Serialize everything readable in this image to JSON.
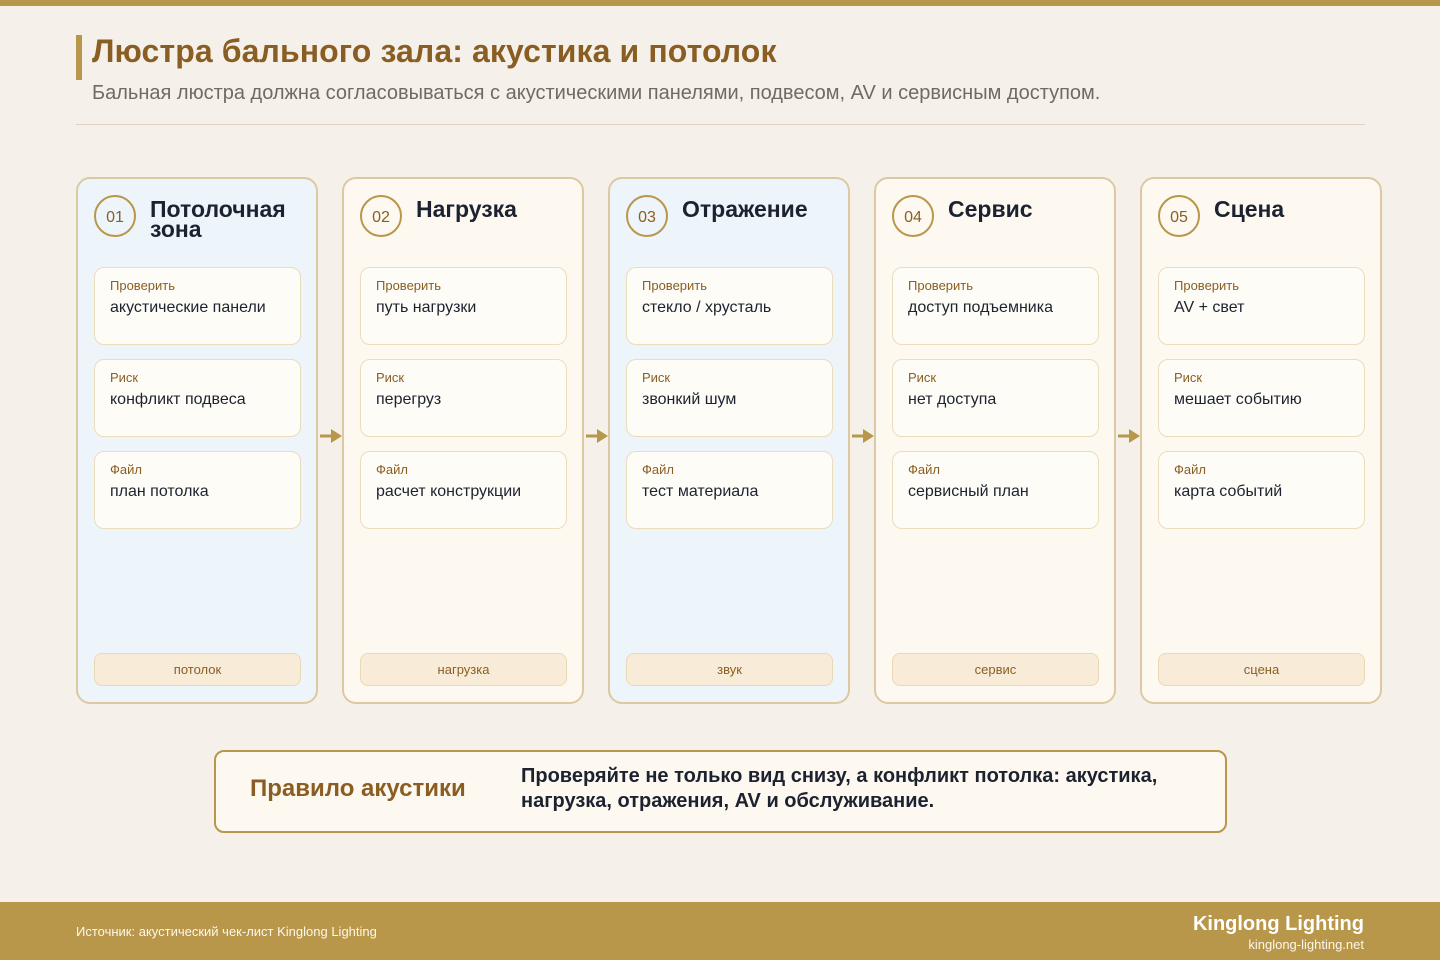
{
  "header": {
    "title": "Люстра бального зала: акустика и потолок",
    "subtitle": "Бальная люстра должна согласовываться с акустическими панелями, подвесом, AV и сервисным доступом."
  },
  "colors": {
    "accent": "#b8974a",
    "accent_dark": "#8a5e22",
    "background": "#f5f1ea",
    "card_blue": "#edf4fa",
    "card_cream": "#fdf9f1"
  },
  "steps": [
    {
      "number": "01",
      "title": "Потолочная зона",
      "tint": "blue",
      "rows": [
        {
          "label": "Проверить",
          "value": "акустические панели"
        },
        {
          "label": "Риск",
          "value": "конфликт подвеса"
        },
        {
          "label": "Файл",
          "value": "план потолка"
        }
      ],
      "tag": "потолок"
    },
    {
      "number": "02",
      "title": "Нагрузка",
      "tint": "cream",
      "rows": [
        {
          "label": "Проверить",
          "value": "путь нагрузки"
        },
        {
          "label": "Риск",
          "value": "перегруз"
        },
        {
          "label": "Файл",
          "value": "расчет конструкции"
        }
      ],
      "tag": "нагрузка"
    },
    {
      "number": "03",
      "title": "Отражение",
      "tint": "blue",
      "rows": [
        {
          "label": "Проверить",
          "value": "стекло / хрусталь"
        },
        {
          "label": "Риск",
          "value": "звонкий шум"
        },
        {
          "label": "Файл",
          "value": "тест материала"
        }
      ],
      "tag": "звук"
    },
    {
      "number": "04",
      "title": "Сервис",
      "tint": "cream",
      "rows": [
        {
          "label": "Проверить",
          "value": "доступ подъемника"
        },
        {
          "label": "Риск",
          "value": "нет доступа"
        },
        {
          "label": "Файл",
          "value": "сервисный план"
        }
      ],
      "tag": "сервис"
    },
    {
      "number": "05",
      "title": "Сцена",
      "tint": "cream",
      "rows": [
        {
          "label": "Проверить",
          "value": "AV + свет"
        },
        {
          "label": "Риск",
          "value": "мешает событию"
        },
        {
          "label": "Файл",
          "value": "карта событий"
        }
      ],
      "tag": "сцена"
    }
  ],
  "rule": {
    "title": "Правило акустики",
    "text": "Проверяйте не только вид снизу, а конфликт потолка: акустика, нагрузка, отражения, AV и обслуживание."
  },
  "footer": {
    "source": "Источник: акустический чек-лист Kinglong Lighting",
    "brand": "Kinglong Lighting",
    "url": "kinglong-lighting.net"
  }
}
